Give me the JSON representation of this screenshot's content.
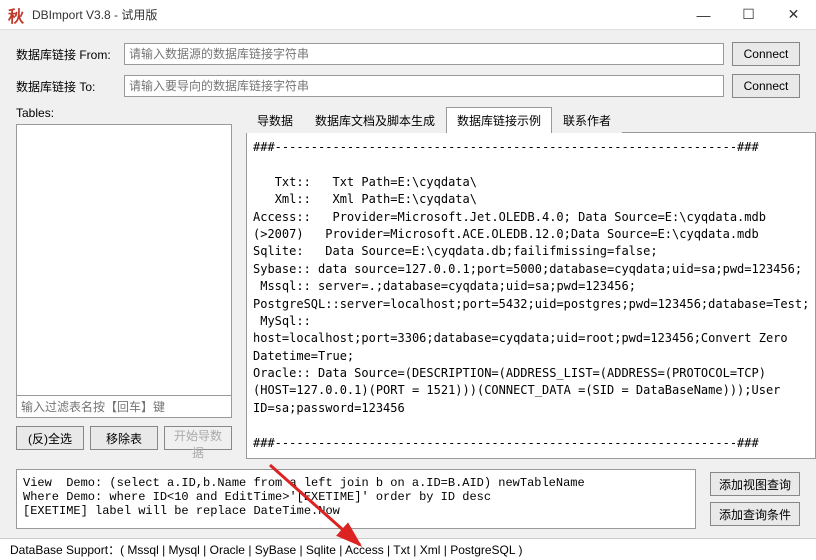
{
  "window": {
    "icon_text": "秋",
    "title": "DBImport V3.8 - 试用版"
  },
  "conn": {
    "from_label": "数据库链接 From:",
    "to_label": "数据库链接 To:",
    "from_placeholder": "请输入数据源的数据库链接字符串",
    "to_placeholder": "请输入要导向的数据库链接字符串",
    "connect_btn": "Connect"
  },
  "tables": {
    "label": "Tables:",
    "filter_placeholder": "输入过滤表名按【回车】键",
    "select_all_btn": "(反)全选",
    "remove_btn": "移除表",
    "start_btn": "开始导数据"
  },
  "tabs": {
    "items": [
      {
        "label": "导数据"
      },
      {
        "label": "数据库文档及脚本生成"
      },
      {
        "label": "数据库链接示例"
      },
      {
        "label": "联系作者"
      }
    ],
    "active_index": 2,
    "example_text": "###----------------------------------------------------------------###\n\n   Txt::   Txt Path=E:\\cyqdata\\\n   Xml::   Xml Path=E:\\cyqdata\\\nAccess::   Provider=Microsoft.Jet.OLEDB.4.0; Data Source=E:\\cyqdata.mdb\n(>2007)   Provider=Microsoft.ACE.OLEDB.12.0;Data Source=E:\\cyqdata.mdb\nSqlite:   Data Source=E:\\cyqdata.db;failifmissing=false;\nSybase:: data source=127.0.0.1;port=5000;database=cyqdata;uid=sa;pwd=123456;\n Mssql:: server=.;database=cyqdata;uid=sa;pwd=123456;\nPostgreSQL::server=localhost;port=5432;uid=postgres;pwd=123456;database=Test;\n MySql:: host=localhost;port=3306;database=cyqdata;uid=root;pwd=123456;Convert Zero Datetime=True;\nOracle:: Data Source=(DESCRIPTION=(ADDRESS_LIST=(ADDRESS=(PROTOCOL=TCP)(HOST=127.0.0.1)(PORT = 1521)))(CONNECT_DATA =(SID = DataBaseName)));User ID=sa;password=123456\n\n###----------------------------------------------------------------###"
  },
  "demo": {
    "text": "View  Demo: (select a.ID,b.Name from a left join b on a.ID=B.AID) newTableName\nWhere Demo: where ID<10 and EditTime>'[EXETIME]' order by ID desc\n[EXETIME] label will be replace DateTime.Now"
  },
  "side": {
    "add_view_btn": "添加视图查询",
    "add_cond_btn": "添加查询条件"
  },
  "status": {
    "text": "DataBase Support：( Mssql | Mysql | Oracle | SyBase | Sqlite | Access | Txt | Xml | PostgreSQL )"
  }
}
